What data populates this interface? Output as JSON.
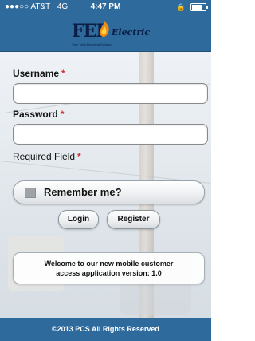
{
  "status_bar": {
    "carrier": "AT&T",
    "network": "4G",
    "time": "4:47 PM",
    "signal_dots": "●●●○○"
  },
  "header": {
    "logo_text": "FEI",
    "logo_wordmark": "Electric",
    "logo_tagline": "Your Total Electrical Solution"
  },
  "form": {
    "username_label": "Username",
    "password_label": "Password",
    "required_mark": "*",
    "required_field_text": "Required Field",
    "username_value": "",
    "password_value": "",
    "remember_label": "Remember me?",
    "remember_checked": false
  },
  "buttons": {
    "login": "Login",
    "register": "Register"
  },
  "welcome": {
    "line1": "Welcome to our new mobile customer",
    "line2": "access application version: 1.0"
  },
  "footer": {
    "copyright": "©2013 PCS All Rights Reserved"
  },
  "colors": {
    "header_bg": "#2f6a9c",
    "footer_bg": "#2f6a9c",
    "required_mark": "#d42f2f",
    "logo_text": "#0b1e46"
  }
}
